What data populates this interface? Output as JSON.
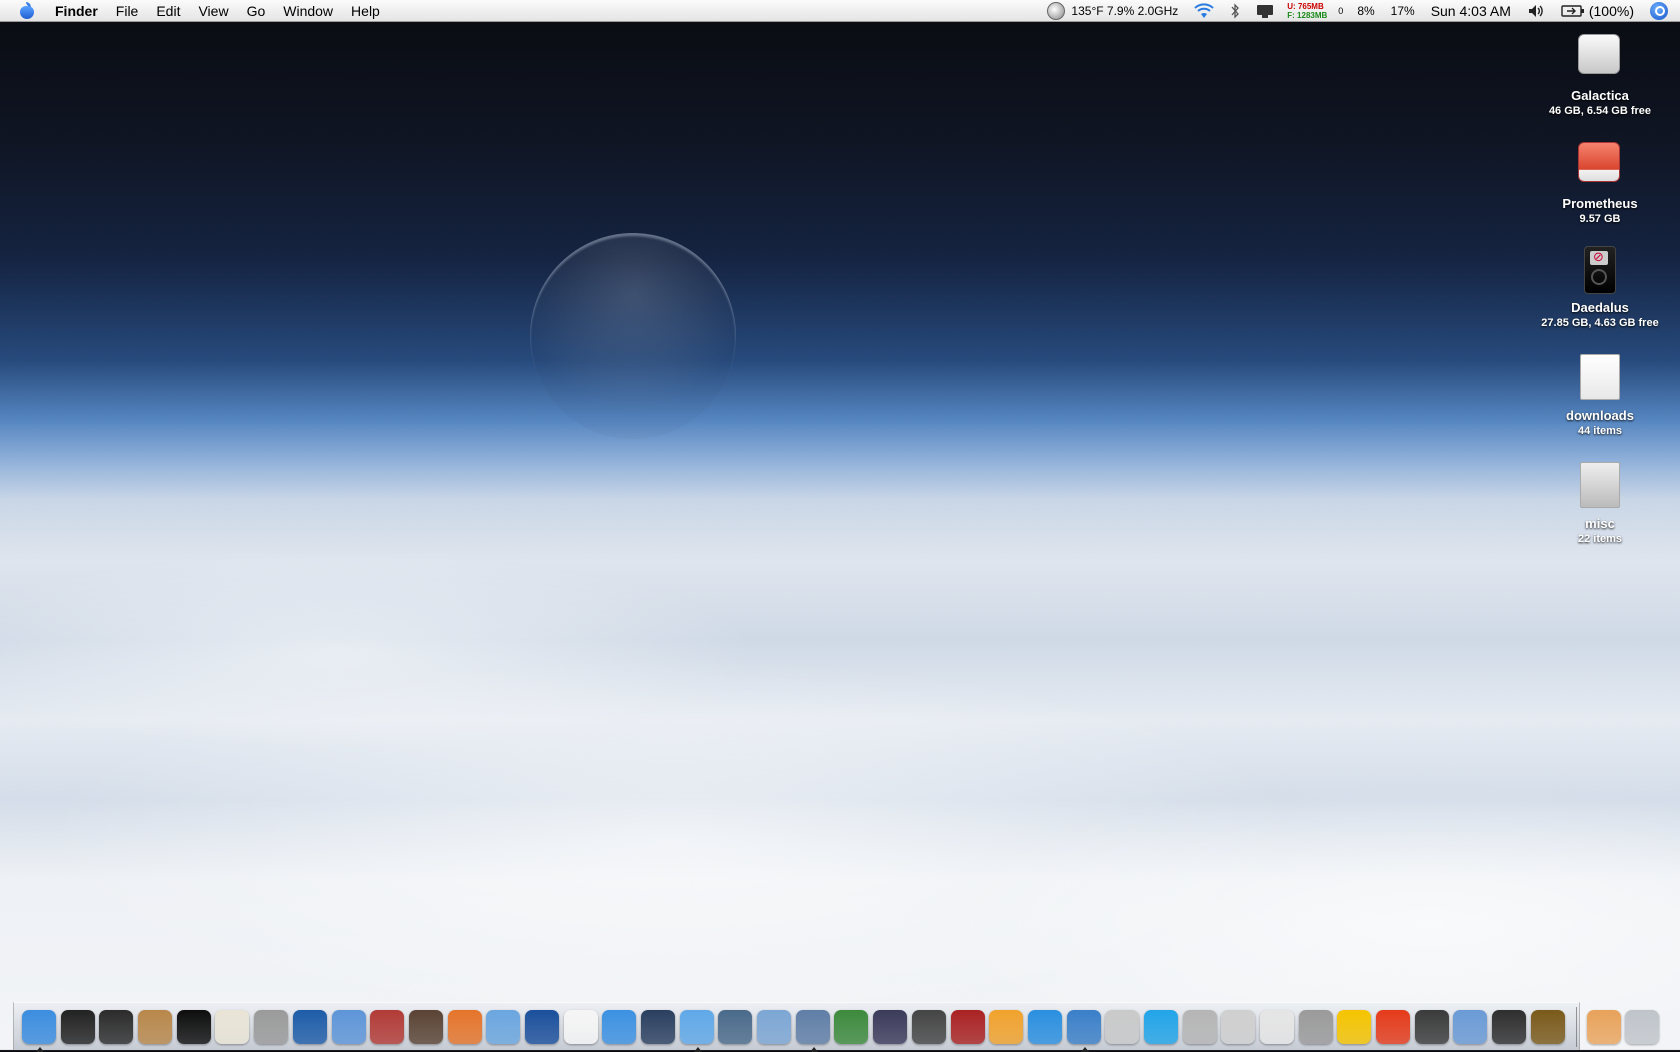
{
  "menubar": {
    "app_name": "Finder",
    "menus": [
      "File",
      "Edit",
      "View",
      "Go",
      "Window",
      "Help"
    ],
    "status": {
      "temp_cpu": "135°F 7.9% 2.0GHz",
      "mem_used": "U: 765MB",
      "mem_free": "F: 1283MB",
      "mem_zero": "0",
      "cpu1": "8%",
      "cpu2": "17%",
      "clock": "Sun 4:03 AM",
      "battery": "(100%)"
    }
  },
  "desktop": {
    "icons": [
      {
        "name": "Galactica",
        "sub": "46 GB, 6.54 GB free",
        "icon": "hard-drive-icon"
      },
      {
        "name": "Prometheus",
        "sub": "9.57 GB",
        "icon": "external-drive-icon"
      },
      {
        "name": "Daedalus",
        "sub": "27.85 GB, 4.63 GB free",
        "icon": "ipod-icon"
      },
      {
        "name": "downloads",
        "sub": "44 items",
        "icon": "folder-icon"
      },
      {
        "name": "misc",
        "sub": "22 items",
        "icon": "folder-icon"
      }
    ]
  },
  "dock": {
    "apps": [
      {
        "name": "finder-icon",
        "color": "#3b8de0",
        "running": true
      },
      {
        "name": "terminal-icon",
        "color": "#222222"
      },
      {
        "name": "activity-monitor-icon",
        "color": "#2b2b2b"
      },
      {
        "name": "address-book-icon",
        "color": "#b8874a"
      },
      {
        "name": "dashboard-icon",
        "color": "#0d0d0d"
      },
      {
        "name": "textedit-icon",
        "color": "#e9e4d6"
      },
      {
        "name": "calculator-icon",
        "color": "#9a9a9a"
      },
      {
        "name": "intel-core-duo-icon",
        "color": "#1d5ca8"
      },
      {
        "name": "app-store-icon",
        "color": "#5d95d8"
      },
      {
        "name": "dictionary-icon",
        "color": "#b23a36"
      },
      {
        "name": "photo-booth-icon",
        "color": "#5a4334"
      },
      {
        "name": "firefox-icon",
        "color": "#e5742a"
      },
      {
        "name": "itunes-icon",
        "color": "#6aa6df"
      },
      {
        "name": "google-earth-icon",
        "color": "#1b4f9c"
      },
      {
        "name": "ical-icon",
        "color": "#f5f5f5"
      },
      {
        "name": "ichat-icon",
        "color": "#3b91e2"
      },
      {
        "name": "image-capture-icon",
        "color": "#2a3f5f"
      },
      {
        "name": "itunes-music-icon",
        "color": "#5fa8e8",
        "running": true
      },
      {
        "name": "system-profiler-icon",
        "color": "#4a6a8a"
      },
      {
        "name": "mac-screen-icon",
        "color": "#7ca6d4"
      },
      {
        "name": "xcode-icon",
        "color": "#5f7ea6",
        "running": true
      },
      {
        "name": "textmate-icon",
        "color": "#3c8a3c"
      },
      {
        "name": "burn-icon",
        "color": "#3a3a5a"
      },
      {
        "name": "quill-icon",
        "color": "#444444"
      },
      {
        "name": "red-book-icon",
        "color": "#aa2222"
      },
      {
        "name": "s-app-icon",
        "color": "#f1a22c"
      },
      {
        "name": "quicktime-icon",
        "color": "#2a8fe0"
      },
      {
        "name": "safari-icon",
        "color": "#3a7fc8",
        "running": true
      },
      {
        "name": "console-icon",
        "color": "#c9c9c9"
      },
      {
        "name": "skype-icon",
        "color": "#21a4e8"
      },
      {
        "name": "preferences-icon",
        "color": "#b5b5b5"
      },
      {
        "name": "magnifier-icon",
        "color": "#cfcfcf"
      },
      {
        "name": "paper-icon",
        "color": "#e5e5e5"
      },
      {
        "name": "x11-icon",
        "color": "#9a9a9a"
      },
      {
        "name": "adium-icon",
        "color": "#f5c400"
      },
      {
        "name": "radiation-icon",
        "color": "#e53a1a"
      },
      {
        "name": "clapper-icon",
        "color": "#3a3a3a"
      },
      {
        "name": "r-app-icon",
        "color": "#6a9ad6"
      },
      {
        "name": "pen-icon",
        "color": "#2e2e2e"
      },
      {
        "name": "warcraft-icon",
        "color": "#7a5a1a"
      }
    ],
    "right": [
      {
        "name": "downloads-stack-icon",
        "color": "#e8a25a"
      },
      {
        "name": "trash-icon",
        "color": "#bfc4ca"
      }
    ]
  }
}
